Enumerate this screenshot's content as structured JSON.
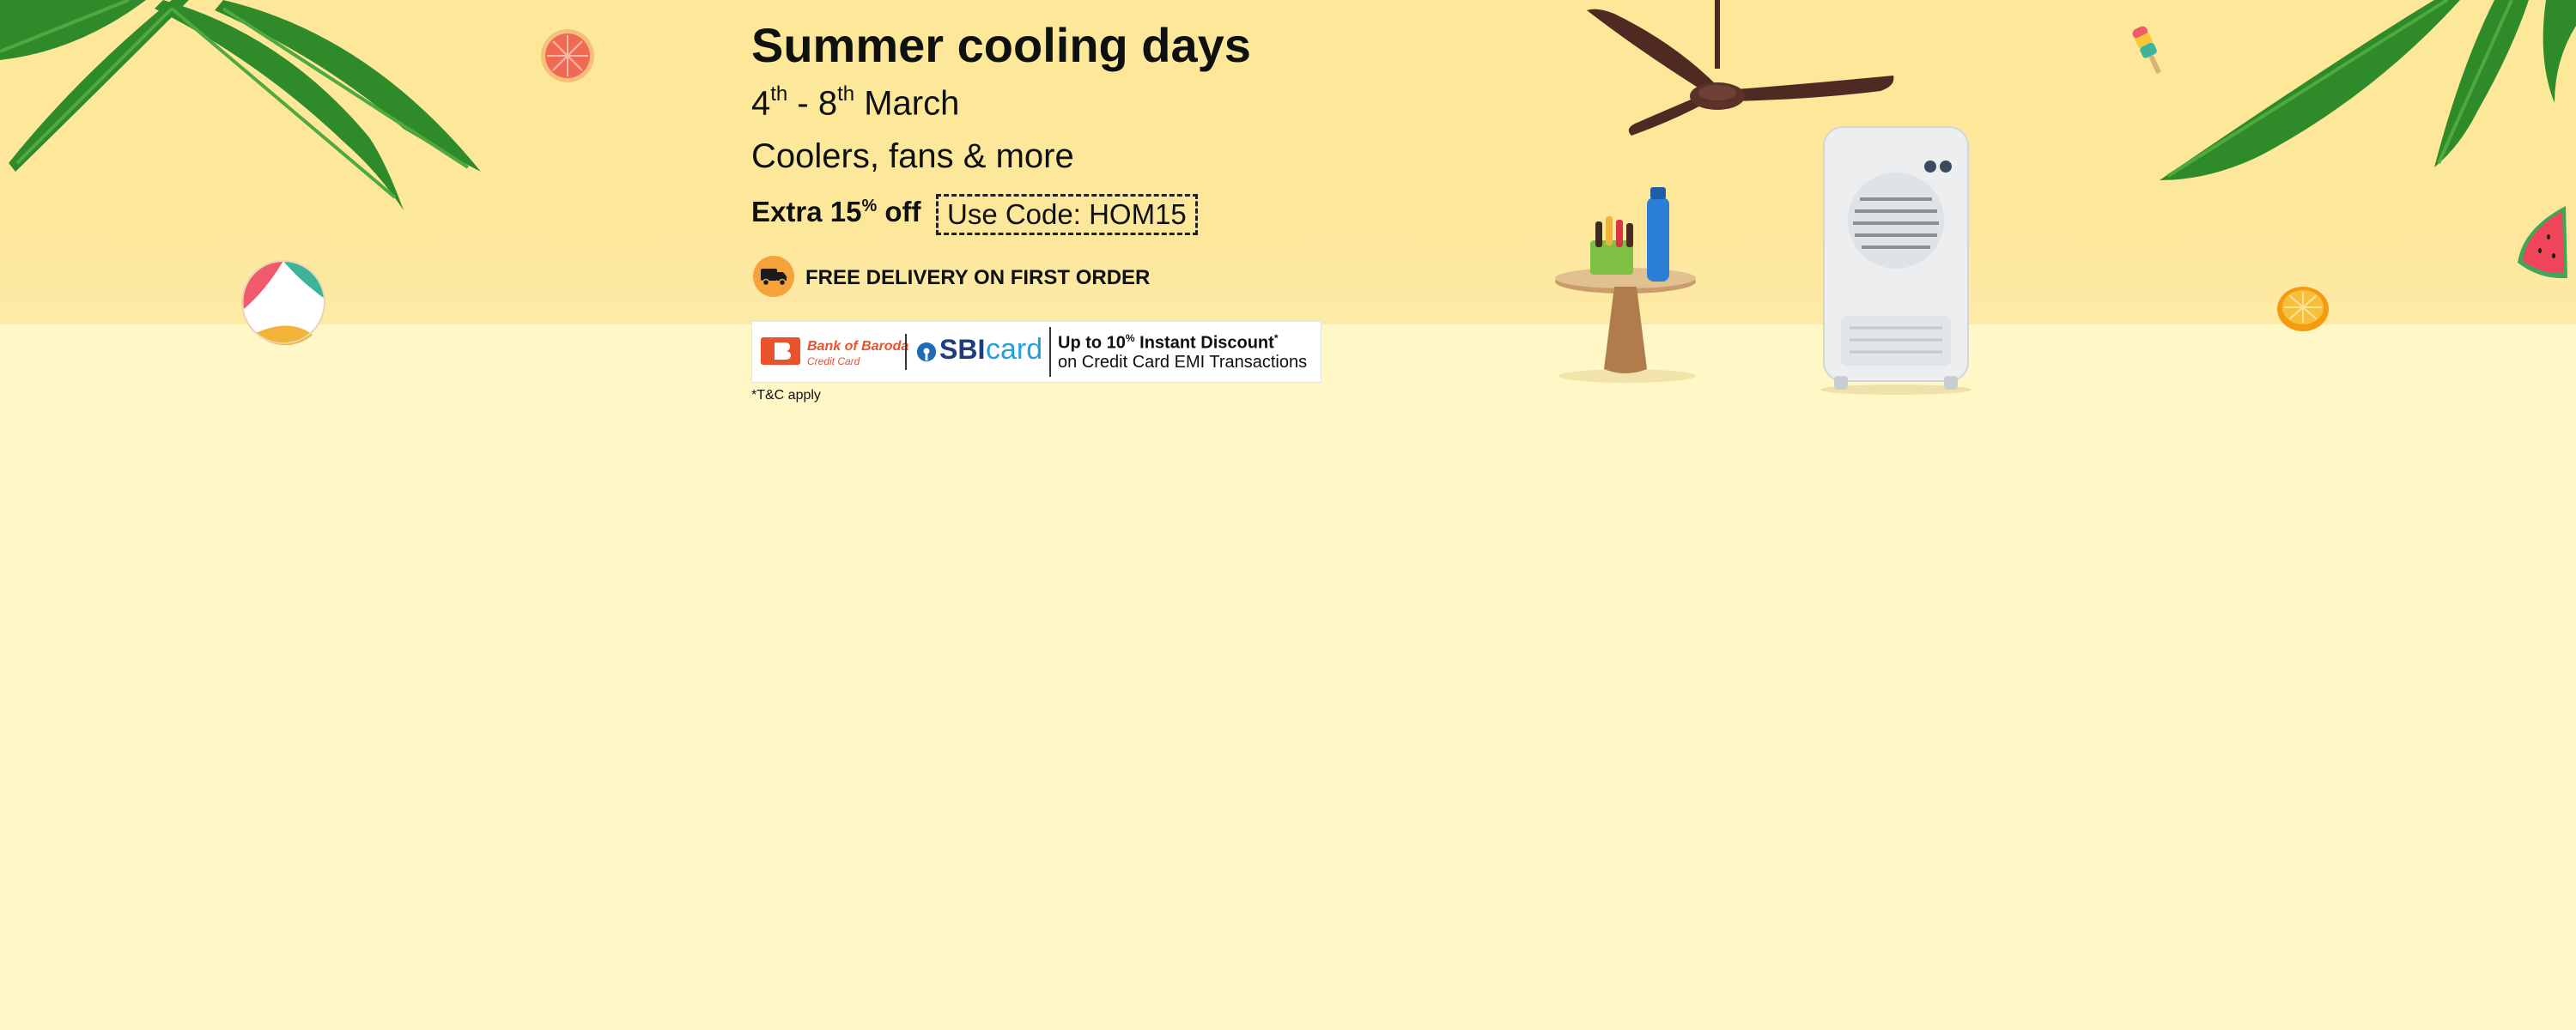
{
  "banner": {
    "title": "Summer cooling days",
    "dates": {
      "start_day": "4",
      "start_sup": "th",
      "separator": " - ",
      "end_day": "8",
      "end_sup": "th",
      "month": " March"
    },
    "subtitle": "Coolers, fans & more",
    "offer": {
      "prefix": "Extra 15",
      "sup": "%",
      "suffix": " off",
      "code_label": "Use Code: HOM15"
    },
    "delivery": "FREE DELIVERY ON FIRST ORDER",
    "bank": {
      "bob_name": "Bank of Baroda",
      "bob_sub": "Credit Card",
      "sbi": "SBI",
      "card": "card",
      "discount_prefix": "Up to 10",
      "discount_sup": "%",
      "discount_suffix": " Instant Discount",
      "discount_star": "*",
      "emi": "on Credit Card EMI Transactions"
    },
    "terms": "*T&C apply"
  },
  "colors": {
    "top_band": "#fde89a",
    "bottom_band": "#fff8c6",
    "delivery_badge": "#f7a33c",
    "bob_orange": "#e8522c",
    "sbi_blue": "#1e3d7a",
    "card_blue": "#27a0d8"
  },
  "decorations": [
    "palm-leaves-left",
    "grapefruit-slice",
    "beach-ball",
    "ceiling-fan",
    "side-table-with-popsicles",
    "water-bottle",
    "air-cooler",
    "popsicle",
    "palm-leaves-right",
    "watermelon-slice",
    "orange-slice"
  ]
}
